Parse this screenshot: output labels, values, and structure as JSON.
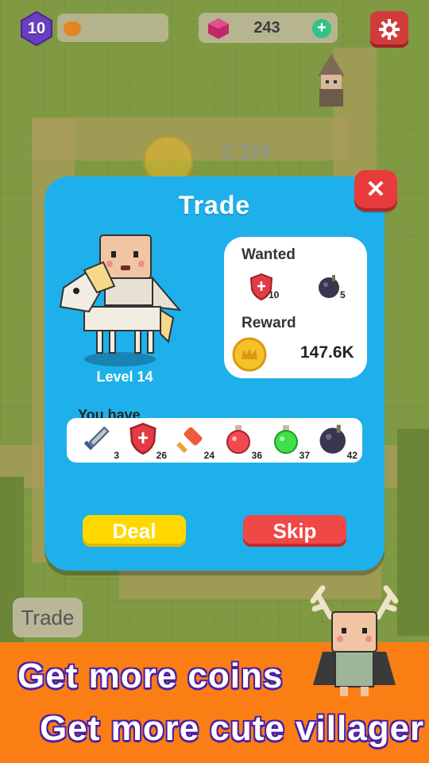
{
  "hud": {
    "player_level": "10",
    "gem_count": "243",
    "add_gems_label": "+"
  },
  "map": {
    "coin_amount": "2.2M",
    "trade_button_label": "Trade"
  },
  "trade_dialog": {
    "title": "Trade",
    "close_label": "✕",
    "villager_level": "Level 14",
    "wanted_title": "Wanted",
    "wanted_items": [
      {
        "icon": "shield-icon",
        "count": "10"
      },
      {
        "icon": "bomb-icon",
        "count": "5"
      }
    ],
    "reward_title": "Reward",
    "reward_value": "147.6K",
    "you_have_title": "You have",
    "inventory": [
      {
        "icon": "sword-icon",
        "count": "3"
      },
      {
        "icon": "shield-icon",
        "count": "26"
      },
      {
        "icon": "hammer-icon",
        "count": "24"
      },
      {
        "icon": "red-potion-icon",
        "count": "36"
      },
      {
        "icon": "green-potion-icon",
        "count": "37"
      },
      {
        "icon": "bomb-icon",
        "count": "42"
      }
    ],
    "deal_label": "Deal",
    "skip_label": "Skip"
  },
  "promo_banner": {
    "line1": "Get more coins",
    "line2": "Get more cute villager"
  },
  "colors": {
    "dialog_blue": "#1eb0ea",
    "deal_yellow": "#ffd800",
    "skip_red": "#f04747",
    "banner_orange": "#fb7e14"
  }
}
